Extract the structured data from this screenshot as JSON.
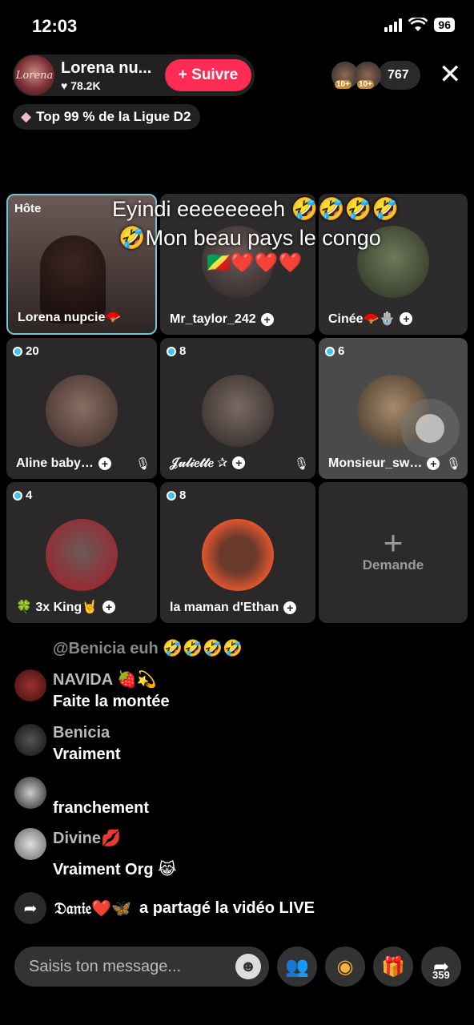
{
  "status": {
    "time": "12:03",
    "battery": "96"
  },
  "host": {
    "name": "Lorena nu...",
    "likes": "78.2K",
    "follow_label": "Suivre",
    "avatar_text": "Lorena"
  },
  "viewers": {
    "badge": "10+",
    "count": "767"
  },
  "league": {
    "text": "Top 99 % de la Ligue D2"
  },
  "overlay": {
    "line1": "Eyindi eeeeeeeeh 🤣🤣🤣🤣",
    "line2": "🤣Mon beau pays le congo",
    "hearts": "🇨🇬❤️❤️❤️"
  },
  "grid": {
    "host_tag": "Hôte",
    "tiles": [
      {
        "name": "Lorena nupcie🪭",
        "count": ""
      },
      {
        "name": "Mr_taylor_242",
        "count": ""
      },
      {
        "name": "Cinée🪭🪬",
        "count": ""
      },
      {
        "name": "Aline baby…",
        "count": "20"
      },
      {
        "name": "𝒥𝓊𝓁𝒾𝑒𝓉𝓉𝑒 ✰",
        "count": "8"
      },
      {
        "name": "Monsieur_sw…",
        "count": "6"
      },
      {
        "name": "🍀 3x King🤘",
        "count": "4"
      },
      {
        "name": "la maman d'Ethan",
        "count": "8"
      }
    ],
    "demande_label": "Demande"
  },
  "chat": {
    "faded": "@Benicia euh 🤣🤣🤣🤣",
    "messages": [
      {
        "name": "NAVIDA 🍓💫",
        "text": "Faite la montée"
      },
      {
        "name": "Benicia",
        "text": "Vraiment"
      },
      {
        "name": "",
        "text": "franchement"
      },
      {
        "name": "Divine💋",
        "text": "Vraiment Org 😹"
      }
    ],
    "share_user": "𝔇𝔞𝔫𝔦𝔢❤️🦋",
    "share_text": "a partagé la vidéo LIVE"
  },
  "bottom": {
    "placeholder": "Saisis ton message...",
    "share_count": "359"
  },
  "colors": {
    "accent": "#fe2c55",
    "host_border": "#6ec6d6",
    "dot": "#3dc5f0"
  }
}
